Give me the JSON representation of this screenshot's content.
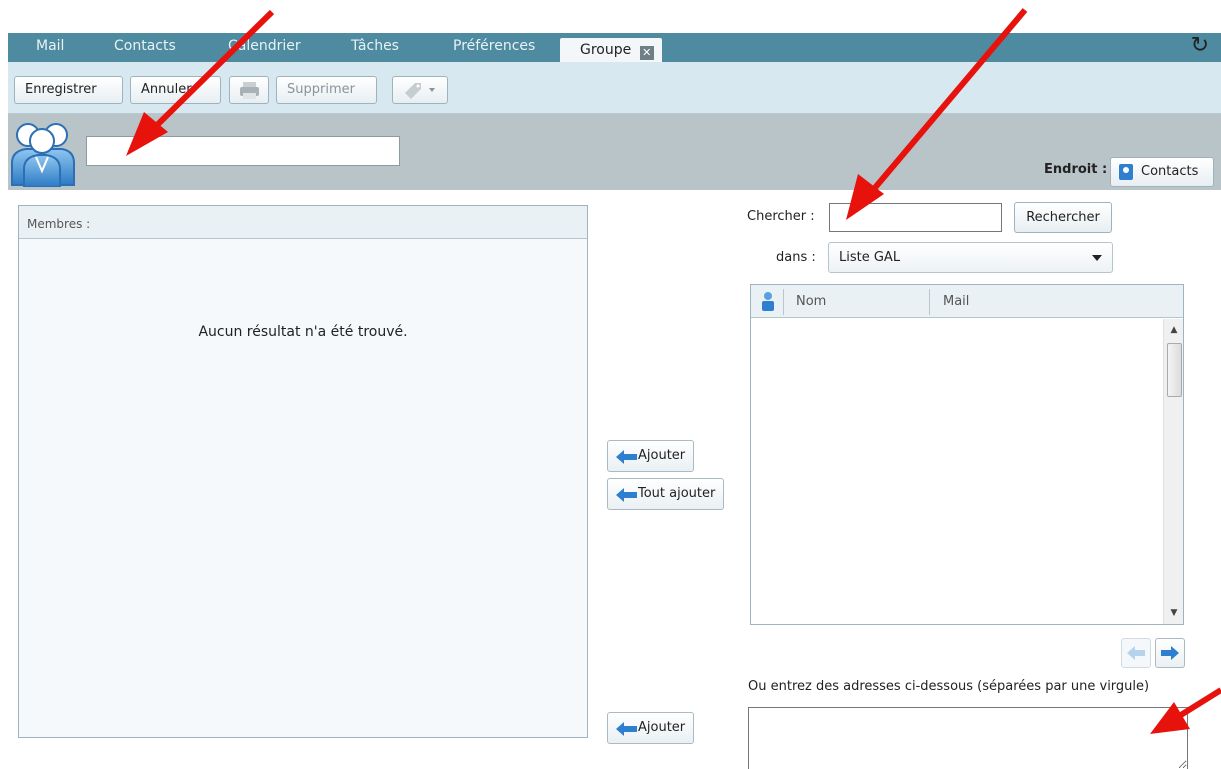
{
  "tabs": [
    {
      "label": "Mail"
    },
    {
      "label": "Contacts"
    },
    {
      "label": "Calendrier"
    },
    {
      "label": "Tâches"
    },
    {
      "label": "Préférences"
    },
    {
      "label": "Groupe",
      "active": true
    }
  ],
  "toolbar": {
    "save_label": "Enregistrer",
    "cancel_label": "Annuler",
    "delete_label": "Supprimer"
  },
  "group": {
    "name_value": "",
    "location_label": "Endroit :",
    "location_value": "Contacts"
  },
  "members": {
    "header": "Membres :",
    "empty_message": "Aucun résultat n'a été trouvé."
  },
  "middle": {
    "add_label": "Ajouter",
    "add_all_label": "Tout ajouter",
    "add_bottom_label": "Ajouter"
  },
  "search": {
    "label": "Chercher :",
    "value": "",
    "button_label": "Rechercher",
    "in_label": "dans :",
    "source_selected": "Liste GAL",
    "columns": [
      "Nom",
      "Mail"
    ]
  },
  "addresses": {
    "label": "Ou entrez des adresses ci-dessous (séparées par une virgule)",
    "value": ""
  },
  "colors": {
    "tabstrip": "#4e8aa0",
    "toolbar": "#d8e8f0",
    "group_band": "#b9c4c9",
    "annotation_arrow": "#e8120c",
    "arrow_button_icon": "#2f7fd0"
  }
}
